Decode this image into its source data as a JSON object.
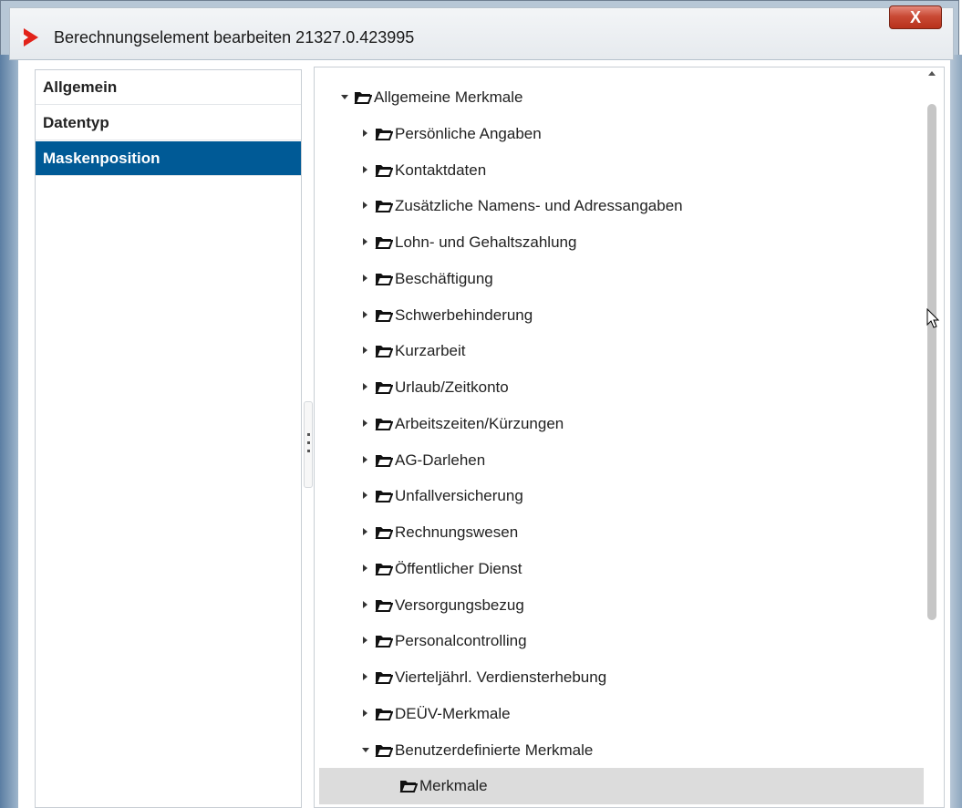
{
  "window": {
    "title": "Berechnungselement bearbeiten 21327.0.423995",
    "close_label": "X"
  },
  "nav": {
    "items": [
      {
        "label": "Allgemein",
        "selected": false
      },
      {
        "label": "Datentyp",
        "selected": false
      },
      {
        "label": "Maskenposition",
        "selected": true
      }
    ]
  },
  "tree": {
    "root": {
      "label": "Allgemeine Merkmale",
      "expanded": true
    },
    "children": [
      {
        "label": "Persönliche Angaben"
      },
      {
        "label": "Kontaktdaten"
      },
      {
        "label": "Zusätzliche Namens- und Adressangaben"
      },
      {
        "label": "Lohn- und Gehaltszahlung"
      },
      {
        "label": "Beschäftigung"
      },
      {
        "label": "Schwerbehinderung"
      },
      {
        "label": "Kurzarbeit"
      },
      {
        "label": "Urlaub/Zeitkonto"
      },
      {
        "label": "Arbeitszeiten/Kürzungen"
      },
      {
        "label": "AG-Darlehen"
      },
      {
        "label": "Unfallversicherung"
      },
      {
        "label": "Rechnungswesen"
      },
      {
        "label": "Öffentlicher Dienst"
      },
      {
        "label": "Versorgungsbezug"
      },
      {
        "label": "Personalcontrolling"
      },
      {
        "label": "Vierteljährl. Verdiensterhebung"
      },
      {
        "label": "DEÜV-Merkmale"
      },
      {
        "label": "Benutzerdefinierte Merkmale",
        "expanded": true
      }
    ],
    "grandchild": {
      "label": "Merkmale",
      "selected": true
    }
  },
  "colors": {
    "selection_nav": "#005a96",
    "selection_tree": "#dcdcdc",
    "close_button": "#c94a35",
    "logo": "#e2231a"
  }
}
